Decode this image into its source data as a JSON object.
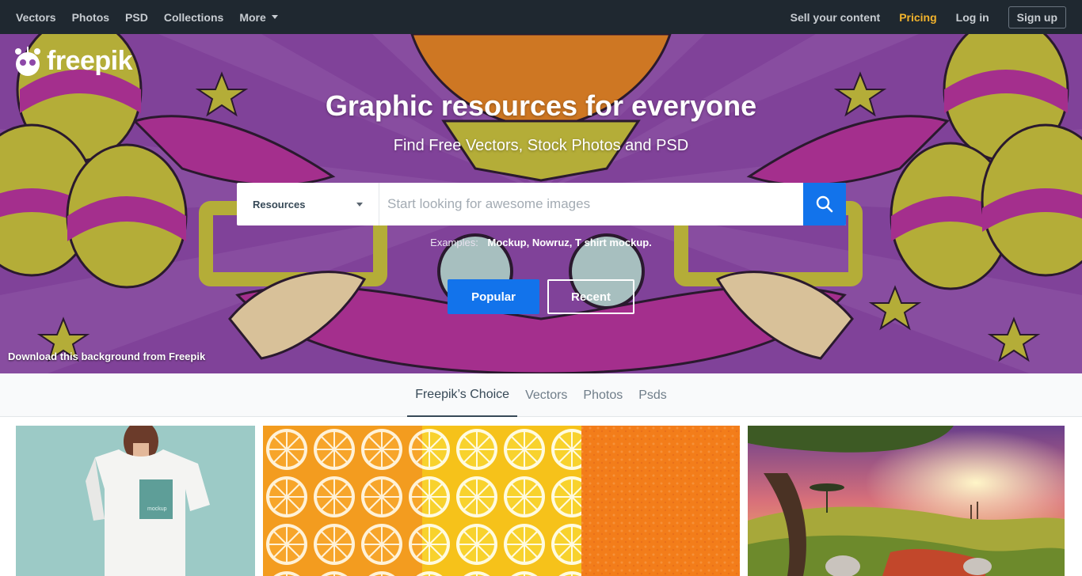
{
  "nav": {
    "left": [
      "Vectors",
      "Photos",
      "PSD",
      "Collections",
      "More"
    ],
    "sell": "Sell your content",
    "pricing": "Pricing",
    "login": "Log in",
    "signup": "Sign up"
  },
  "logo": {
    "text": "freepik"
  },
  "hero": {
    "title": "Graphic resources for everyone",
    "subtitle": "Find Free Vectors, Stock Photos and PSD",
    "search": {
      "type_label": "Resources",
      "placeholder": "Start looking for awesome images",
      "value": ""
    },
    "examples": {
      "label": "Examples:",
      "items": [
        "Mockup,",
        "Nowruz,",
        "T shirt mockup."
      ]
    },
    "popular": "Popular",
    "recent": "Recent",
    "credit": "Download this background from Freepik"
  },
  "tabs": [
    "Freepik’s Choice",
    "Vectors",
    "Photos",
    "Psds"
  ],
  "thumbs": {
    "mockup_label": "mockup"
  },
  "icons": {
    "logo": "freepik-logo-icon",
    "search": "search-icon",
    "more": "chevron-down-icon",
    "select": "chevron-down-icon"
  },
  "colors": {
    "nav_bg": "#1f2830",
    "pricing": "#f3b42c",
    "accent": "#1273eb",
    "hero_bg": "#8d48a8"
  }
}
